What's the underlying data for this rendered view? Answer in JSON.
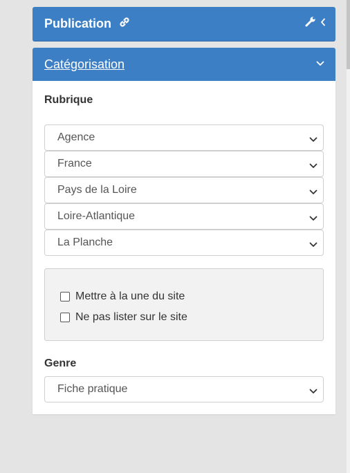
{
  "publication": {
    "title": "Publication"
  },
  "categorisation": {
    "title": "Catégorisation",
    "rubrique_label": "Rubrique",
    "rubrique_selects": [
      "Agence",
      "France",
      "Pays de la Loire",
      "Loire-Atlantique",
      "La Planche"
    ],
    "options": [
      "Mettre à la une du site",
      "Ne pas lister sur le site"
    ],
    "genre_label": "Genre",
    "genre_value": "Fiche pratique"
  },
  "icons": {
    "publication": [
      "link-icon",
      "wrench-icon",
      "chevron-left-icon"
    ],
    "categorisation": [
      "chevron-down-icon"
    ]
  },
  "colors": {
    "header": "#3c7fc4",
    "background": "#e4e4e4"
  }
}
